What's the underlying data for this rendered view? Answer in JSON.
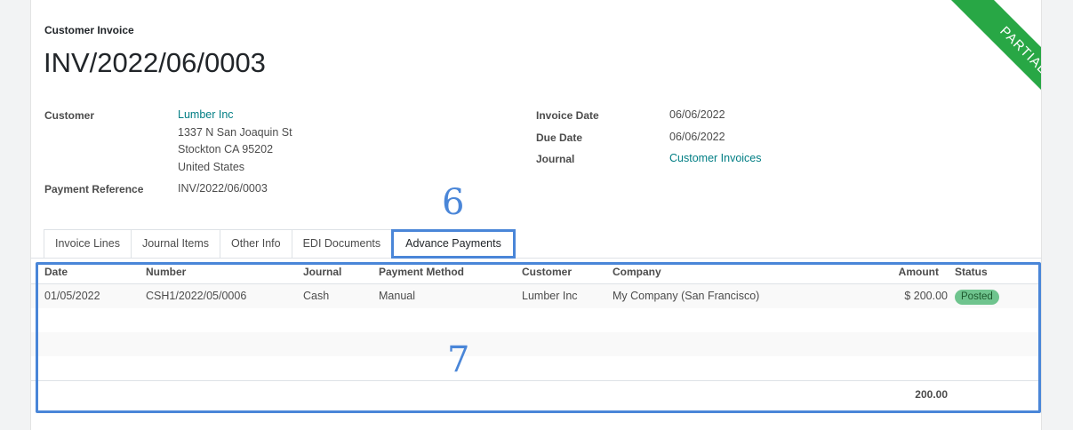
{
  "header": {
    "doc_type": "Customer Invoice",
    "doc_name": "INV/2022/06/0003",
    "ribbon": "PARTIAL"
  },
  "fields": {
    "customer_label": "Customer",
    "customer_name": "Lumber Inc",
    "address_line1": "1337 N San Joaquin St",
    "address_line2": "Stockton CA 95202",
    "address_line3": "United States",
    "payment_ref_label": "Payment Reference",
    "payment_ref_value": "INV/2022/06/0003",
    "invoice_date_label": "Invoice Date",
    "invoice_date_value": "06/06/2022",
    "due_date_label": "Due Date",
    "due_date_value": "06/06/2022",
    "journal_label": "Journal",
    "journal_value": "Customer Invoices"
  },
  "tabs": [
    "Invoice Lines",
    "Journal Items",
    "Other Info",
    "EDI Documents",
    "Advance Payments"
  ],
  "annotations": {
    "tab_marker": "6",
    "panel_marker": "7"
  },
  "table": {
    "columns": [
      "Date",
      "Number",
      "Journal",
      "Payment Method",
      "Customer",
      "Company",
      "Amount",
      "Status"
    ],
    "rows": [
      {
        "date": "01/05/2022",
        "number": "CSH1/2022/05/0006",
        "journal": "Cash",
        "payment_method": "Manual",
        "customer": "Lumber Inc",
        "company": "My Company (San Francisco)",
        "amount": "$ 200.00",
        "status": "Posted"
      }
    ],
    "total": "200.00"
  },
  "colors": {
    "ribbon": "#28a745",
    "link": "#017e84",
    "annotation": "#4a86d8",
    "status_badge": "#6fc48e"
  }
}
